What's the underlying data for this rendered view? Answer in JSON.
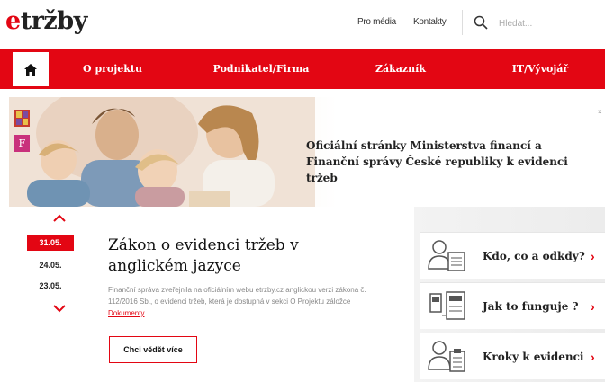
{
  "header": {
    "logo_prefix": "e",
    "logo_rest": "tržby",
    "links": [
      "Pro média",
      "Kontakty"
    ],
    "search_placeholder": "Hledat..."
  },
  "nav": {
    "items": [
      "O projektu",
      "Podnikatel/Firma",
      "Zákazník",
      "IT/Vývojář"
    ]
  },
  "hero": {
    "badge2": "F",
    "text": "Oficiální stránky Ministerstva financí a Finanční správy České republiky k evidenci tržeb"
  },
  "news": {
    "dates": [
      "31.05.",
      "24.05.",
      "23.05."
    ],
    "title": "Zákon o evidenci tržeb v anglickém jazyce",
    "body": "Finanční správa zveřejnila na oficiálním webu etrzby.cz anglickou verzi zákona č. 112/2016 Sb., o evidenci tržeb, která je dostupná v sekci O Projektu záložce",
    "link": "Dokumenty",
    "cta": "Chci vědět více"
  },
  "side": {
    "items": [
      {
        "label": "Kdo, co a odkdy?",
        "icon": "person-document-icon"
      },
      {
        "label": "Jak to funguje ?",
        "icon": "terminal-register-icon"
      },
      {
        "label": "Kroky k evidenci",
        "icon": "person-checklist-icon"
      }
    ]
  },
  "colors": {
    "accent": "#e30613",
    "text": "#222222"
  }
}
